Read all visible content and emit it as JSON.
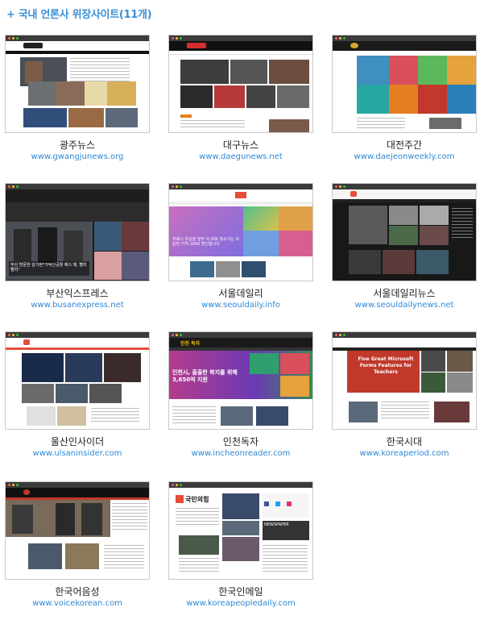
{
  "section_title": "+ 국내 언론사 위장사이트(11개)",
  "sites": [
    {
      "name": "광주뉴스",
      "url": "www.gwangjunews.org"
    },
    {
      "name": "대구뉴스",
      "url": "www.daegunews.net"
    },
    {
      "name": "대전주간",
      "url": "www.daejeonweekly.com"
    },
    {
      "name": "부산익스프레스",
      "url": "www.busanexpress.net"
    },
    {
      "name": "서울데일리",
      "url": "www.seouldaily.info"
    },
    {
      "name": "서울데일리뉴스",
      "url": "www.seouldailynews.net"
    },
    {
      "name": "울산인사이더",
      "url": "www.ulsaninsider.com"
    },
    {
      "name": "인천독자",
      "url": "www.incheonreader.com"
    },
    {
      "name": "한국시대",
      "url": "www.koreaperiod.com"
    },
    {
      "name": "한국어음성",
      "url": "www.voicekorean.com"
    },
    {
      "name": "한국인메일",
      "url": "www.koreapeopledaily.com"
    }
  ],
  "thumb_text": {
    "busan_headline": "부산 방문한 김기현\"가덕신공항 예스 돼, 빨리 빨리\"",
    "seouldaily_headline": "코로나 조심을 앞두 이 로또 청소기는 오늘만 가격 1650 할인합니다",
    "incheon_label": "인천 독자",
    "incheon_headline": "인천시, 출출한 복지를 위해 3,650억 지원",
    "koreaperiod_headline": "Five Great Microsoft Forms Features for Teachers",
    "koreapeople_party": "국민의힘",
    "koreapeople_newspaper": "NEWSPAPER"
  },
  "colors": {
    "title": "#3a8fd8",
    "link": "#2f88d6"
  }
}
